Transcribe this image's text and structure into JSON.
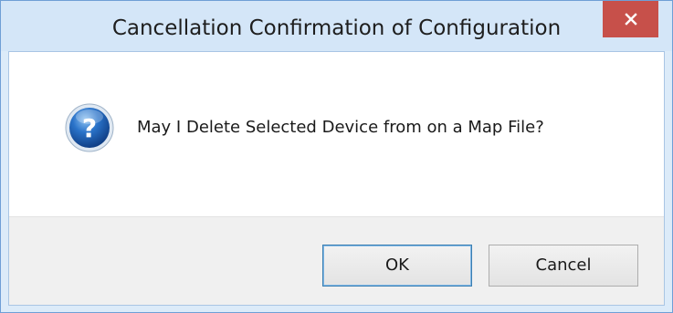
{
  "window": {
    "title": "Cancellation Confirmation of Configuration",
    "close_icon": "close-icon"
  },
  "dialog": {
    "icon": "question-icon",
    "message": "May I Delete Selected Device from on a Map File?"
  },
  "buttons": {
    "ok_label": "OK",
    "cancel_label": "Cancel"
  },
  "colors": {
    "titlebar": "#d4e6f8",
    "close_button": "#c7504a",
    "button_area": "#f0f0f0",
    "icon_blue": "#1f5fb8"
  }
}
